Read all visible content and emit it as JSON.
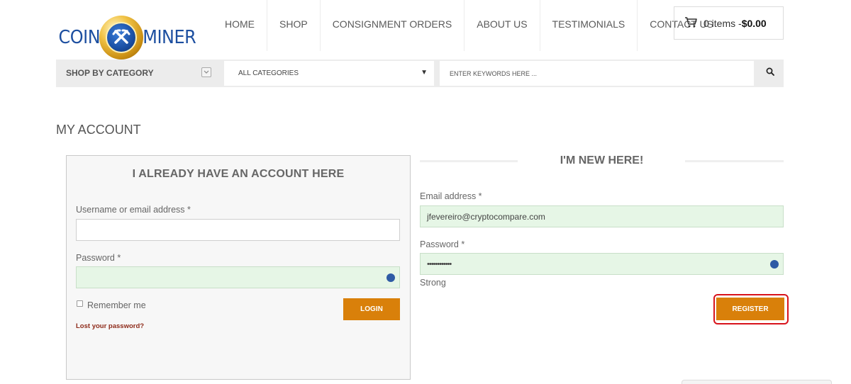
{
  "brand": {
    "logo_left": "COIN",
    "logo_right": "MINER"
  },
  "nav": {
    "items": [
      {
        "label": "HOME"
      },
      {
        "label": "SHOP"
      },
      {
        "label": "CONSIGNMENT ORDERS"
      },
      {
        "label": "ABOUT US"
      },
      {
        "label": "TESTIMONIALS"
      },
      {
        "label": "CONTACT US"
      }
    ]
  },
  "cart": {
    "items_text": "0 items - ",
    "total": "$0.00"
  },
  "search": {
    "category_label": "SHOP BY CATEGORY",
    "select_value": "ALL CATEGORIES",
    "keyword_placeholder": "ENTER KEYWORDS HERE ..."
  },
  "page": {
    "title": "MY ACCOUNT"
  },
  "login": {
    "heading": "I ALREADY HAVE AN ACCOUNT HERE",
    "username_label": "Username or email address *",
    "username_value": "",
    "password_label": "Password *",
    "password_value": "",
    "remember_label": "Remember me",
    "login_button": "LOGIN",
    "lost_password": "Lost your password?"
  },
  "register": {
    "heading": "I'M NEW HERE!",
    "email_label": "Email address *",
    "email_value": "jfevereiro@cryptocompare.com",
    "password_label": "Password *",
    "password_value": "••••••••••••",
    "strength": "Strong",
    "register_button": "REGISTER"
  },
  "colors": {
    "accent": "#d9800a",
    "logo_blue": "#1d4fa0",
    "filled_field": "#e6f6e6",
    "highlight": "#d8131b",
    "link": "#8e2b1a"
  }
}
